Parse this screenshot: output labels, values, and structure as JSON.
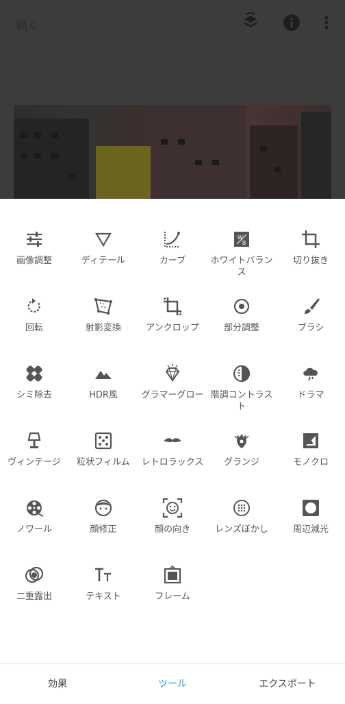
{
  "topbar": {
    "open_label": "開く",
    "icons": [
      "layers-swap-icon",
      "info-icon",
      "more-vert-icon"
    ]
  },
  "tools": [
    {
      "label": "画像調整",
      "icon": "tune-icon"
    },
    {
      "label": "ディテール",
      "icon": "triangle-icon"
    },
    {
      "label": "カーブ",
      "icon": "curve-icon"
    },
    {
      "label": "ホワイトバランス",
      "icon": "white-balance-icon"
    },
    {
      "label": "切り抜き",
      "icon": "crop-icon"
    },
    {
      "label": "回転",
      "icon": "rotate-icon"
    },
    {
      "label": "射影変換",
      "icon": "perspective-icon"
    },
    {
      "label": "アンクロップ",
      "icon": "expand-icon"
    },
    {
      "label": "部分調整",
      "icon": "selective-icon"
    },
    {
      "label": "ブラシ",
      "icon": "brush-icon"
    },
    {
      "label": "シミ除去",
      "icon": "healing-icon"
    },
    {
      "label": "HDR風",
      "icon": "hdr-mountain-icon"
    },
    {
      "label": "グラマーグロー",
      "icon": "diamond-icon"
    },
    {
      "label": "階調コントラスト",
      "icon": "tonal-contrast-icon"
    },
    {
      "label": "ドラマ",
      "icon": "cloud-storm-icon"
    },
    {
      "label": "ヴィンテージ",
      "icon": "lamp-icon"
    },
    {
      "label": "粒状フィルム",
      "icon": "dice-icon"
    },
    {
      "label": "レトロラックス",
      "icon": "mustache-icon"
    },
    {
      "label": "グランジ",
      "icon": "guitar-icon"
    },
    {
      "label": "モノクロ",
      "icon": "monochrome-icon"
    },
    {
      "label": "ノワール",
      "icon": "film-reel-icon"
    },
    {
      "label": "顔修正",
      "icon": "face-icon"
    },
    {
      "label": "顔の向き",
      "icon": "face-frame-icon"
    },
    {
      "label": "レンズぼかし",
      "icon": "lens-blur-icon"
    },
    {
      "label": "周辺減光",
      "icon": "vignette-icon"
    },
    {
      "label": "二重露出",
      "icon": "double-exposure-icon"
    },
    {
      "label": "テキスト",
      "icon": "text-icon"
    },
    {
      "label": "フレーム",
      "icon": "frame-icon"
    }
  ],
  "bottom_nav": [
    {
      "label": "効果",
      "active": false
    },
    {
      "label": "ツール",
      "active": true
    },
    {
      "label": "エクスポート",
      "active": false
    }
  ],
  "colors": {
    "accent": "#2196f3",
    "icon": "#555555",
    "overlay": "#3c3c3c"
  }
}
